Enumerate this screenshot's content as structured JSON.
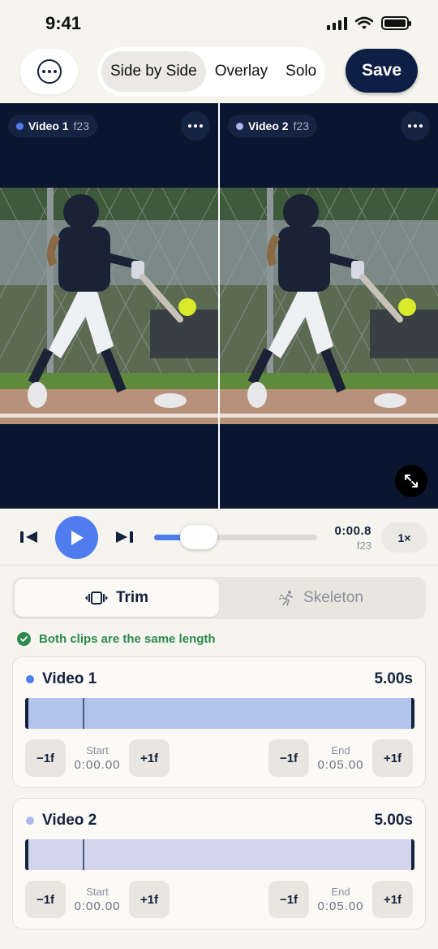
{
  "status_bar": {
    "time": "9:41"
  },
  "toolbar": {
    "view_modes": [
      "Side by Side",
      "Overlay",
      "Solo"
    ],
    "active_view_mode": "Side by Side",
    "save_label": "Save"
  },
  "videos": [
    {
      "label": "Video 1",
      "frame": "f23",
      "color": "#4f7df0"
    },
    {
      "label": "Video 2",
      "frame": "f23",
      "color": "#a9b8ee"
    }
  ],
  "playback": {
    "time": "0:00.8",
    "frame": "f23",
    "speed": "1×",
    "progress_fraction": 0.16
  },
  "modes": {
    "trim": "Trim",
    "skeleton": "Skeleton",
    "active": "Trim"
  },
  "status_message": "Both clips are the same length",
  "clips": [
    {
      "name": "Video 1",
      "duration": "5.00s",
      "dot_color": "#4f7df0",
      "track_color": "#b3c4ec",
      "minus": "−1f",
      "plus": "+1f",
      "start_label": "Start",
      "start_value": "0:00.00",
      "end_label": "End",
      "end_value": "0:05.00"
    },
    {
      "name": "Video 2",
      "duration": "5.00s",
      "dot_color": "#a9b8ee",
      "track_color": "#d3d5ec",
      "minus": "−1f",
      "plus": "+1f",
      "start_label": "Start",
      "start_value": "0:00.00",
      "end_label": "End",
      "end_value": "0:05.00"
    }
  ],
  "colors": {
    "accent": "#4f7df0",
    "navy": "#0e1f45",
    "success": "#2d8a4e"
  }
}
